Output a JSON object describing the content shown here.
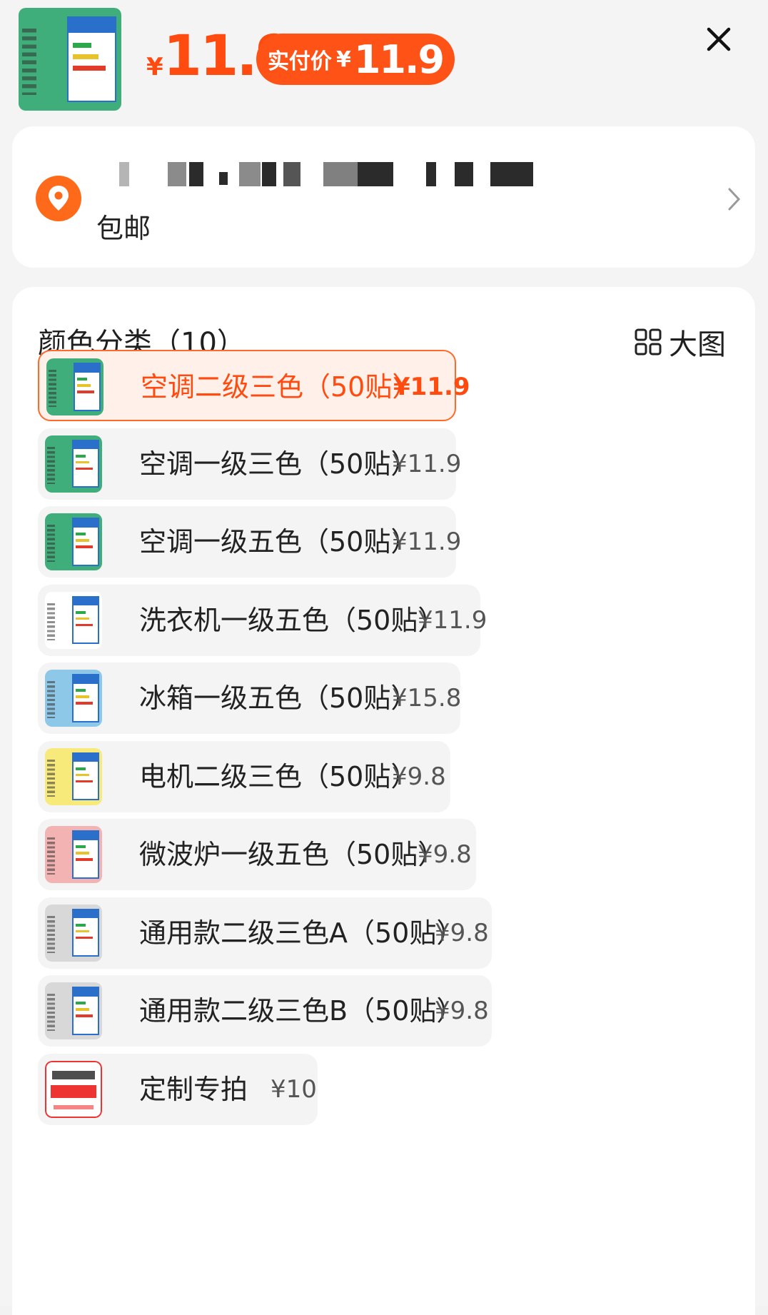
{
  "header": {
    "thumb_icon": "energy-label-thumbnail",
    "currency": "¥",
    "price": "11.9",
    "pay_label": "实付价",
    "pay_currency": "¥",
    "pay_price": "11.9",
    "close_icon": "close-icon"
  },
  "address": {
    "pin_icon": "location-pin-icon",
    "shipping": "包邮",
    "chevron_icon": "chevron-right-icon"
  },
  "options": {
    "title": "颜色分类（10）",
    "big_view_label": "大图",
    "items": [
      {
        "name": "空调二级三色（50贴）",
        "price": "¥11.9",
        "selected": true,
        "thumb_color": "#3fae7a"
      },
      {
        "name": "空调一级三色（50贴）",
        "price": "¥11.9",
        "selected": false,
        "thumb_color": "#3fae7a"
      },
      {
        "name": "空调一级五色（50贴）",
        "price": "¥11.9",
        "selected": false,
        "thumb_color": "#3fae7a"
      },
      {
        "name": "洗衣机一级五色（50贴）",
        "price": "¥11.9",
        "selected": false,
        "thumb_color": "#ffffff"
      },
      {
        "name": "冰箱一级五色（50贴）",
        "price": "¥15.8",
        "selected": false,
        "thumb_color": "#8ec8e8"
      },
      {
        "name": "电机二级三色（50贴）",
        "price": "¥9.8",
        "selected": false,
        "thumb_color": "#f7ea7a"
      },
      {
        "name": "微波炉一级五色（50贴）",
        "price": "¥9.8",
        "selected": false,
        "thumb_color": "#f3b3b3"
      },
      {
        "name": "通用款二级三色A（50贴）",
        "price": "¥9.8",
        "selected": false,
        "thumb_color": "#d8d8d8"
      },
      {
        "name": "通用款二级三色B（50贴）",
        "price": "¥9.8",
        "selected": false,
        "thumb_color": "#d8d8d8"
      },
      {
        "name": "定制专拍",
        "price": "¥10",
        "selected": false,
        "thumb_color": "#ffffff"
      }
    ]
  },
  "colors": {
    "accent": "#ff4b0f",
    "selected_bg": "#fff1ea"
  }
}
